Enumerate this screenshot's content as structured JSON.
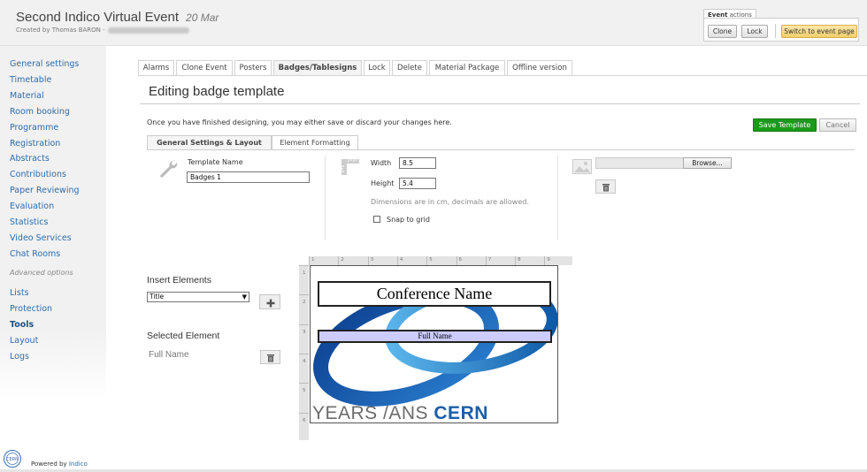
{
  "event": {
    "title": "Second Indico Virtual Event",
    "date": "20 Mar",
    "created_by_prefix": "Created by Thomas BARON -"
  },
  "event_actions": {
    "header_bold": "Event",
    "header_rest": " actions",
    "clone": "Clone",
    "lock": "Lock",
    "switch": "Switch to event page"
  },
  "sidebar": {
    "items": [
      {
        "label": "General settings"
      },
      {
        "label": "Timetable"
      },
      {
        "label": "Material"
      },
      {
        "label": "Room booking"
      },
      {
        "label": "Programme"
      },
      {
        "label": "Registration"
      },
      {
        "label": "Abstracts"
      },
      {
        "label": "Contributions"
      },
      {
        "label": "Paper Reviewing"
      },
      {
        "label": "Evaluation"
      },
      {
        "label": "Statistics"
      },
      {
        "label": "Video Services"
      },
      {
        "label": "Chat Rooms"
      }
    ],
    "advanced_label": "Advanced options",
    "advanced_items": [
      {
        "label": "Lists"
      },
      {
        "label": "Protection"
      },
      {
        "label": "Tools",
        "active": true
      },
      {
        "label": "Layout"
      },
      {
        "label": "Logs"
      }
    ]
  },
  "tabs": [
    {
      "label": "Alarms"
    },
    {
      "label": "Clone Event"
    },
    {
      "label": "Posters"
    },
    {
      "label": "Badges/Tablesigns",
      "active": true
    },
    {
      "label": "Lock"
    },
    {
      "label": "Delete"
    },
    {
      "label": "Material Package"
    },
    {
      "label": "Offline version"
    }
  ],
  "page": {
    "heading": "Editing badge template",
    "info": "Once you have finished designing, you may either save or discard your changes here.",
    "save_label": "Save Template",
    "cancel_label": "Cancel"
  },
  "subtabs": [
    {
      "label": "General Settings & Layout",
      "active": true
    },
    {
      "label": "Element Formatting"
    }
  ],
  "settings": {
    "template_name_label": "Template Name",
    "template_name_value": "Badges 1",
    "width_label": "Width",
    "width_value": "8.5",
    "height_label": "Height",
    "height_value": "5.4",
    "dimensions_hint": "Dimensions are in cm, decimals are allowed.",
    "snap_label": "Snap to grid",
    "snap_checked": false,
    "browse_label": "Browse..."
  },
  "elements": {
    "insert_title": "Insert Elements",
    "insert_selected": "Title",
    "selected_title": "Selected Element",
    "selected_value": "Full Name"
  },
  "ruler": {
    "top": [
      "1",
      "2",
      "3",
      "4",
      "5",
      "6",
      "7",
      "8",
      "9"
    ],
    "left": [
      "1",
      "2",
      "3",
      "4",
      "5",
      "6"
    ]
  },
  "badge": {
    "title_text": "Conference Name",
    "name_text": "Full Name",
    "background_text": "YEARS /ANS",
    "background_brand": "CERN"
  },
  "footer": {
    "powered_by": "Powered by",
    "indico": "Indico"
  },
  "colors": {
    "link": "#2e6caa",
    "save_green": "#1a9a1a",
    "name_box": "#ccccff",
    "cern_blue": "#1b5ea8"
  }
}
